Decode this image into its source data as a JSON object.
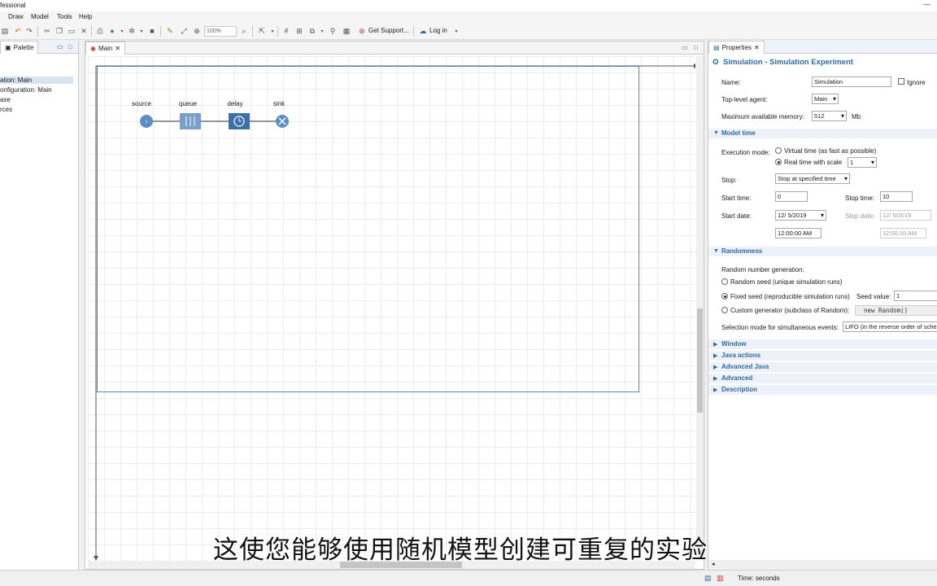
{
  "window": {
    "title": "fessional"
  },
  "menu": [
    "Draw",
    "Model",
    "Tools",
    "Help"
  ],
  "toolbar": {
    "zoom": "100%",
    "support_label": "Get Support...",
    "login_label": "Log in"
  },
  "palette_pane": {
    "tab_label": "Palette",
    "items": [
      "ation: Main",
      "onfiguration: Main",
      "ase",
      "rces"
    ]
  },
  "main_pane": {
    "tab_label": "Main",
    "blocks": [
      {
        "label": "source",
        "icon": "source-icon",
        "color": "#5b8fc4"
      },
      {
        "label": "queue",
        "icon": "queue-icon",
        "color": "#7aa0c9"
      },
      {
        "label": "delay",
        "icon": "clock-icon",
        "color": "#3f6fa8"
      },
      {
        "label": "sink",
        "icon": "sink-icon",
        "color": "#5b8fc4"
      }
    ]
  },
  "subtitle": "这使您能够使用随机模型创建可重复的实验",
  "properties": {
    "tab_label": "Properties",
    "title": "Simulation - Simulation Experiment",
    "name_label": "Name:",
    "name_value": "Simulation",
    "ignore_label": "Ignore",
    "top_agent_label": "Top-level agent:",
    "top_agent_value": "Main",
    "memory_label": "Maximum available memory:",
    "memory_value": "512",
    "memory_unit": "Mb",
    "model_time": {
      "title": "Model time",
      "exec_mode_label": "Execution mode:",
      "virtual_time_label": "Virtual time (as fast as possible)",
      "real_time_label": "Real time with scale",
      "scale_value": "1",
      "stop_label": "Stop:",
      "stop_value": "Stop at specified time",
      "start_time_label": "Start time:",
      "start_time_value": "0",
      "stop_time_label": "Stop time:",
      "stop_time_value": "10",
      "start_date_label": "Start date:",
      "start_date_value": "12/  5/2019",
      "stop_date_label": "Stop date:",
      "stop_date_value": "12/  5/2019",
      "start_clock_value": "12:00:00 AM",
      "stop_clock_value": "12:00:10 AM"
    },
    "randomness": {
      "title": "Randomness",
      "rng_label": "Random number generation:",
      "random_seed_label": "Random seed (unique simulation runs)",
      "fixed_seed_label": "Fixed seed (reproducible simulation runs)",
      "seed_value_label": "Seed value:",
      "seed_value": "1",
      "custom_gen_label": "Custom generator (subclass of Random):",
      "custom_gen_value": "new Random()",
      "selection_mode_label": "Selection mode for simultaneous events:",
      "selection_mode_value": "LIFO (in the reverse order of sche"
    },
    "collapsed_sections": [
      "Window",
      "Java actions",
      "Advanced Java",
      "Advanced",
      "Description"
    ]
  },
  "status": {
    "time_label": "Time: seconds"
  },
  "colors": {
    "accent": "#2d6ca2",
    "frame": "#5d84b5",
    "section_bg": "#eef2f8"
  }
}
